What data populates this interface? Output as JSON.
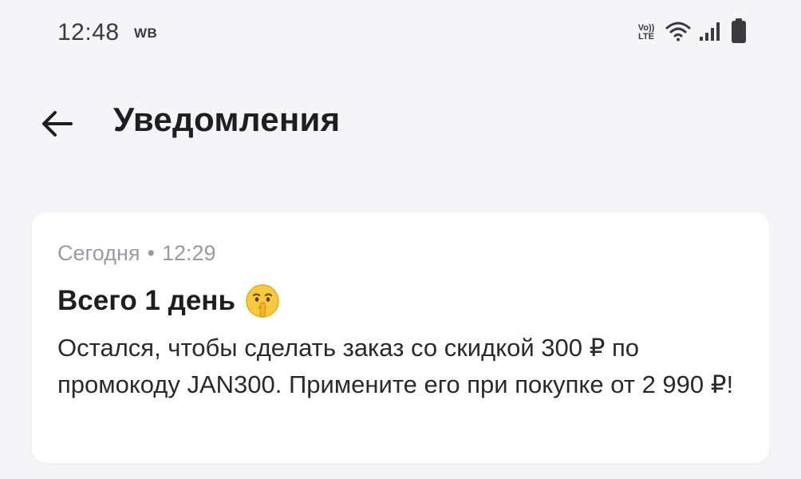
{
  "status_bar": {
    "time": "12:48",
    "app_badge": "WB",
    "network_label_top": "Vo))",
    "network_label_bottom": "LTE"
  },
  "header": {
    "title": "Уведомления"
  },
  "notification": {
    "date": "Сегодня",
    "separator": "•",
    "time": "12:29",
    "title": "Всего 1 день",
    "emoji": "shushing-face",
    "body": "Остался, чтобы сделать заказ со скидкой 300 ₽ по промокоду JAN300. Примените его при покупке от 2 990 ₽!"
  },
  "colors": {
    "background": "#f5f5f8",
    "card": "#ffffff",
    "text_primary": "#1e1e22",
    "text_secondary": "#9a9aa2"
  }
}
